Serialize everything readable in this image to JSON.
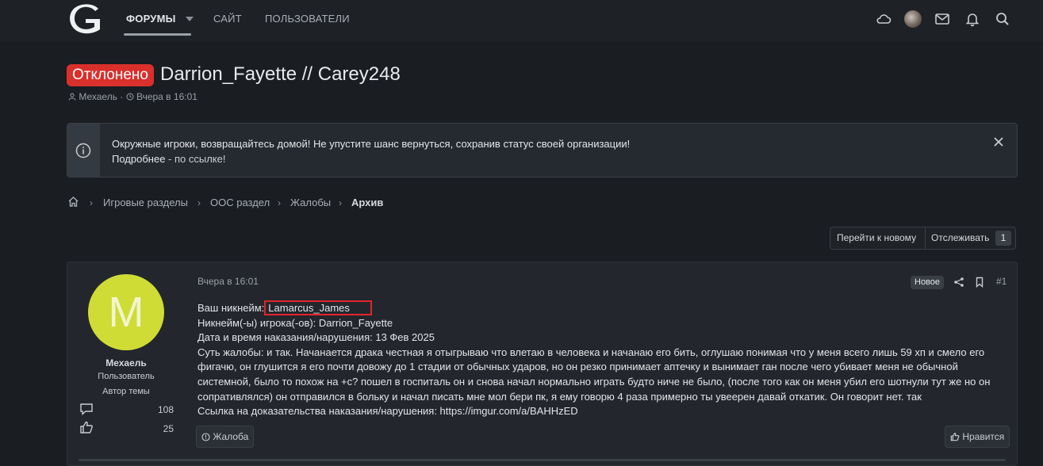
{
  "nav": {
    "tabs": [
      "ФОРУМЫ",
      "САЙТ",
      "ПОЛЬЗОВАТЕЛИ"
    ],
    "icons": [
      "cloud-icon",
      "avatar",
      "mail-icon",
      "bell-icon",
      "search-icon"
    ]
  },
  "thread": {
    "status": "Отклонено",
    "status_color": "#d9302c",
    "title": "Darrion_Fayette // Carey248",
    "author": "Мехаель",
    "time": "Вчера в 16:01"
  },
  "notice": {
    "line1": "Окружные игроки, возвращайтесь домой! Не упустите шанс вернуться, сохранив статус своей организации!",
    "line2_link": "Подробнее",
    "line2_rest": " - по ссылке!"
  },
  "breadcrumb": [
    "Игровые разделы",
    "OOC раздел",
    "Жалобы",
    "Архив"
  ],
  "actions": {
    "goto_new": "Перейти к новому",
    "watch": "Отслеживать",
    "watch_count": "1"
  },
  "post": {
    "user": {
      "avatar_letter": "M",
      "avatar_color": "#cfdc35",
      "name": "Мехаель",
      "role": "Пользователь",
      "author_label": "Автор темы",
      "messages": "108",
      "reactions": "25"
    },
    "date": "Вчера в 16:01",
    "new_label": "Новое",
    "number": "#1",
    "lines": {
      "nick_label": "Ваш никнейм:",
      "nick_value": "Lamarcus_James",
      "l2": "Никнейм(-ы) игрока(-ов): Darrion_Fayette",
      "l3": "Дата и время наказания/нарушения: 13 Фев 2025",
      "l4": "Суть жалобы: и так. Начанается драка честная я отыгрываю что влетаю в человека и начанаю его бить, оглушаю понимая что у меня всего лишь 59 хп и смело его",
      "l5": "фигачю, он глушится я его почти довожу до 1 стадии от обычных ударов, но он резко принимает аптечку и вынимает ган после чего убивает меня не обычной",
      "l6": "системной, было то похож на +с? пошел в госпиталь он и снова начал нормально играть будто ниче не было, (после того как он меня убил его шотнули тут же но он",
      "l7": "сопративлялся) он отправился в больку и начал писать мне мол бери пк, я ему говорю 4 раза примерно ты увеерен давай откатик. Он говорит нет. так",
      "l8": "Ссылка на доказательства наказания/нарушения: https://imgur.com/a/BAHHzED"
    },
    "report_label": "Жалоба",
    "like_label": "Нравится"
  }
}
